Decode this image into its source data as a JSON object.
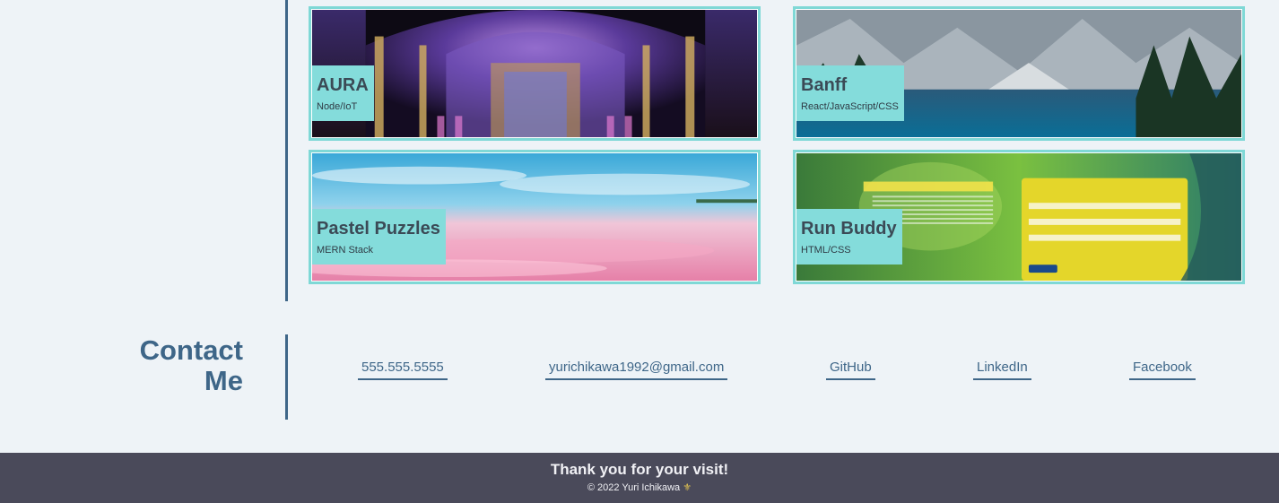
{
  "projects": [
    {
      "name": "AURA",
      "tech": "Node/IoT",
      "image": "cathedral-interior-image"
    },
    {
      "name": "Banff",
      "tech": "React/JavaScript/CSS",
      "image": "mountain-lake-image"
    },
    {
      "name": "Pastel Puzzles",
      "tech": "MERN Stack",
      "image": "pink-beach-image"
    },
    {
      "name": "Run Buddy",
      "tech": "HTML/CSS",
      "image": "fitness-signup-image"
    }
  ],
  "contact": {
    "title_line1": "Contact",
    "title_line2": "Me",
    "links": [
      {
        "label": "555.555.5555"
      },
      {
        "label": "yurichikawa1992@gmail.com"
      },
      {
        "label": "GitHub"
      },
      {
        "label": "LinkedIn"
      },
      {
        "label": "Facebook"
      }
    ]
  },
  "footer": {
    "thanks": "Thank you for your visit!",
    "copyright": "© 2022 Yuri Ichikawa",
    "emblem": "⚜"
  },
  "colors": {
    "background": "#eef3f7",
    "accent": "#3e6688",
    "card_border": "#7fd8d6",
    "label_bg": "#84dcdb",
    "footer_bg": "#4a4a5a"
  }
}
